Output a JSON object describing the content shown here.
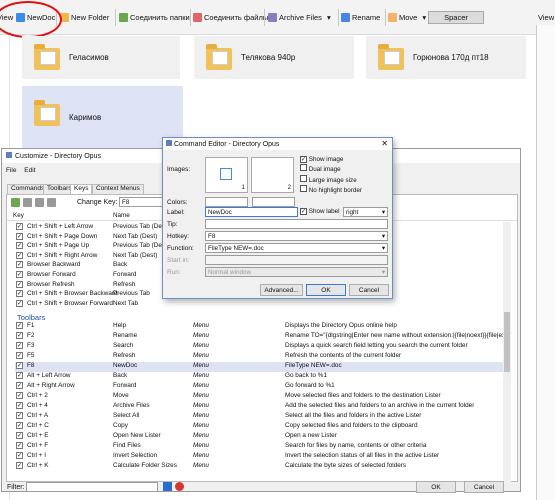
{
  "toolbar": {
    "view": "View",
    "newdoc": "NewDoc",
    "newfolder": "New Folder",
    "joinfolders": "Соединить папки",
    "joinfiles": "Соединить файлы",
    "archive": "Archive Files",
    "rename": "Rename",
    "move": "Move",
    "spacer": "Spacer",
    "right": "View"
  },
  "tiles": [
    "Геласимов",
    "Телякова 940р",
    "Горюнова 170д пт18",
    "Каримов"
  ],
  "customize": {
    "title": "Customize - Directory Opus",
    "menu": [
      "File",
      "Edit"
    ],
    "tabs": [
      "Commands",
      "Toolbars",
      "Keys",
      "Context Menus"
    ],
    "change_key_label": "Change Key:",
    "change_key_value": "F8",
    "col_key": "Key",
    "col_name": "Name",
    "top_rows": [
      [
        "Ctrl + Shift + Left Arrow",
        "Previous Tab (Dest)"
      ],
      [
        "Ctrl + Shift + Page Down",
        "Next Tab (Dest)"
      ],
      [
        "Ctrl + Shift + Page Up",
        "Previous Tab (Dest)"
      ],
      [
        "Ctrl + Shift + Right Arrow",
        "Next Tab (Dest)"
      ],
      [
        "Browser Backward",
        "Back"
      ],
      [
        "Browser Forward",
        "Forward"
      ],
      [
        "Browser Refresh",
        "Refresh"
      ],
      [
        "Ctrl + Shift + Browser Backward",
        "Previous Tab"
      ],
      [
        "Ctrl + Shift + Browser Forward",
        "Next Tab"
      ]
    ],
    "section": "Toolbars",
    "rows": [
      [
        "F1",
        "Help",
        "Menu",
        "Displays the Directory Opus online help"
      ],
      [
        "F2",
        "Rename",
        "Menu",
        "Rename TO=\"{dlgstring|Enter new name without extension:|{file|noext}}{file|ext}\""
      ],
      [
        "F3",
        "Search",
        "Menu",
        "Displays a quick search field letting you search the current folder"
      ],
      [
        "F5",
        "Refresh",
        "Menu",
        "Refresh the contents of the current folder"
      ],
      [
        "F8",
        "NewDoc",
        "Menu",
        "FileType NEW=.doc"
      ],
      [
        "Alt + Left Arrow",
        "Back",
        "Menu",
        "Go back to %1"
      ],
      [
        "Alt + Right Arrow",
        "Forward",
        "Menu",
        "Go forward to %1"
      ],
      [
        "Ctrl + 2",
        "Move",
        "Menu",
        "Move selected files and folders to the destination Lister"
      ],
      [
        "Ctrl + 4",
        "Archive Files",
        "Menu",
        "Add the selected files and folders to an archive in the current folder"
      ],
      [
        "Ctrl + A",
        "Select All",
        "Menu",
        "Select all the files and folders in the active Lister"
      ],
      [
        "Ctrl + C",
        "Copy",
        "Menu",
        "Copy selected files and folders to the clipboard"
      ],
      [
        "Ctrl + E",
        "Open New Lister",
        "Menu",
        "Open a new Lister"
      ],
      [
        "Ctrl + F",
        "Find Files",
        "Menu",
        "Search for files by name, contents or other criteria"
      ],
      [
        "Ctrl + I",
        "Invert Selection",
        "Menu",
        "Invert the selection status of all files in the active Lister"
      ],
      [
        "Ctrl + K",
        "Calculate Folder Sizes",
        "Menu",
        "Calculate the byte sizes of selected folders"
      ]
    ],
    "filter_label": "Filter:",
    "ok": "OK",
    "cancel": "Cancel"
  },
  "editor": {
    "title": "Command Editor - Directory Opus",
    "images_label": "Images:",
    "img1": "1",
    "img2": "2",
    "show_image": "Show image",
    "dual_image": "Dual image",
    "large_image": "Large image size",
    "no_highlight": "No highlight border",
    "colors_label": "Colors:",
    "label_label": "Label:",
    "label_value": "NewDoc",
    "show_label": "Show label",
    "label_pos": "right",
    "tip_label": "Tip:",
    "tip_value": "",
    "hotkey_label": "Hotkey:",
    "hotkey_value": "F8",
    "function_label": "Function:",
    "function_value": "FileType NEW=.doc",
    "startin_label": "Start in:",
    "run_label": "Run:",
    "run_value": "Normal window",
    "advanced": "Advanced...",
    "ok": "OK",
    "cancel": "Cancel"
  }
}
